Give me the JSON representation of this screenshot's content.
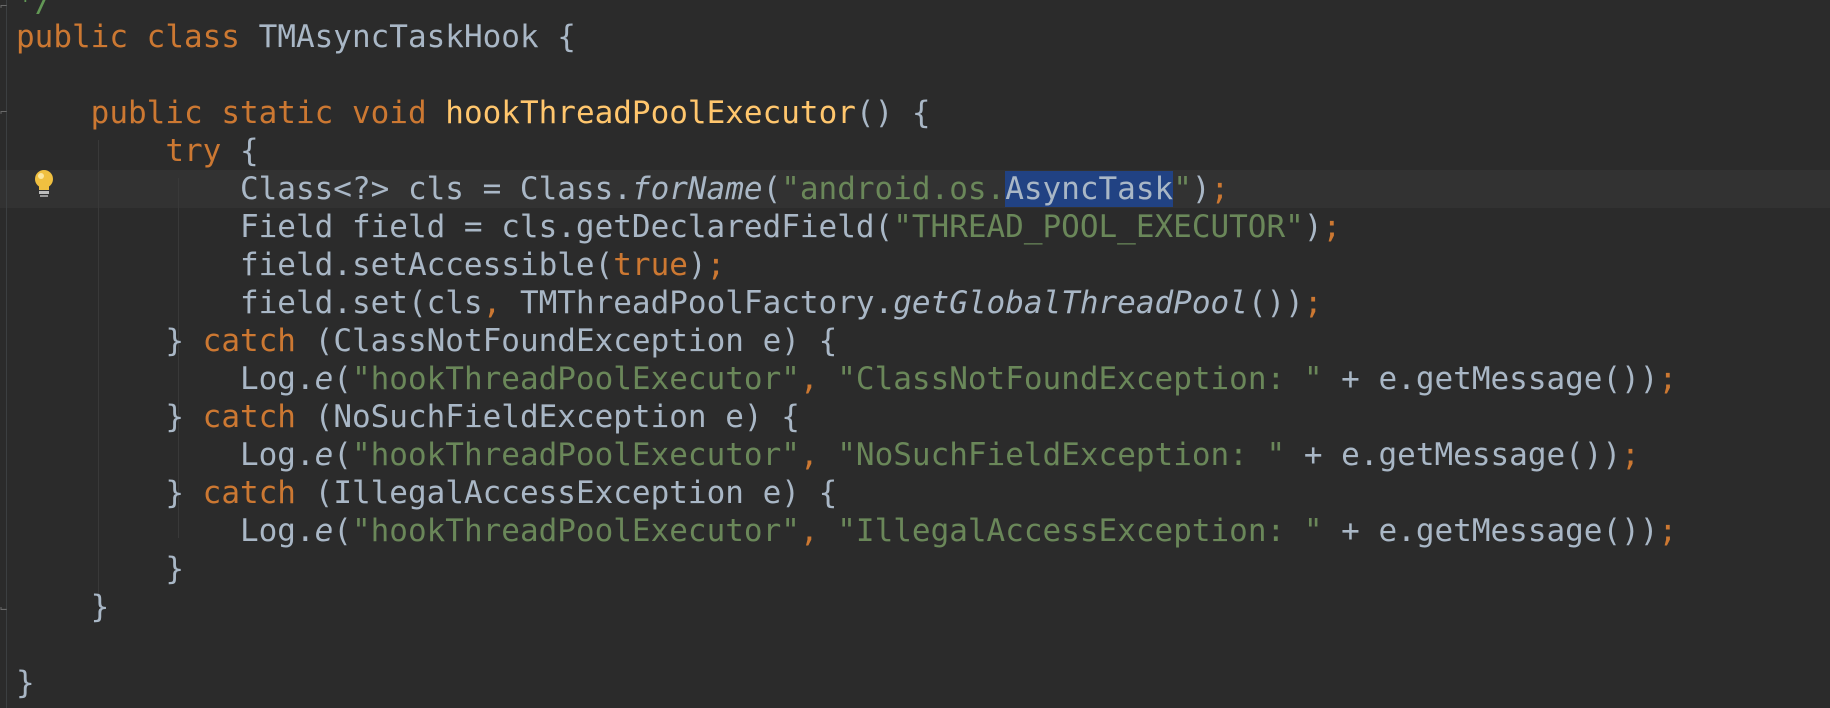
{
  "colors": {
    "background": "#2b2b2b",
    "keyword": "#cc7832",
    "method_decl": "#ffc66d",
    "string": "#6a8759",
    "text": "#a9b7c6",
    "selection": "#214283",
    "current_line": "#323232"
  },
  "icons": {
    "bulb": "lightbulb-icon",
    "fold": "fold-marker-icon"
  },
  "code": {
    "comment_tail": "*/",
    "l1": {
      "kw1": "public",
      "kw2": "class",
      "name": "TMAsyncTaskHook",
      "brace": "{"
    },
    "l3": {
      "kw1": "public",
      "kw2": "static",
      "kw3": "void",
      "method": "hookThreadPoolExecutor",
      "rest": "() {"
    },
    "l4": {
      "kw": "try",
      "rest": "{"
    },
    "l5": {
      "a": "Class<?> cls = Class.",
      "method": "forName",
      "paren": "(",
      "str_open": "\"android.os.",
      "selected": "AsyncTask",
      "str_close": "\"",
      "close": ")",
      "semi": ";"
    },
    "l6": {
      "a": "Field field = cls.getDeclaredField(",
      "str": "\"THREAD_POOL_EXECUTOR\"",
      "close": ")",
      "semi": ";"
    },
    "l7": {
      "a": "field.setAccessible(",
      "kw": "true",
      "close": ")",
      "semi": ";"
    },
    "l8": {
      "a": "field.set(cls",
      "comma": ",",
      "b": " TMThreadPoolFactory.",
      "method": "getGlobalThreadPool",
      "close": "())",
      "semi": ";"
    },
    "l9": {
      "brace": "}",
      "kw": "catch",
      "rest": "(ClassNotFoundException e) {"
    },
    "l10": {
      "a": "Log.",
      "method": "e",
      "paren": "(",
      "tag": "\"hookThreadPoolExecutor\"",
      "comma": ",",
      "msg": "\"ClassNotFoundException: \"",
      "rest": " + e.getMessage())",
      "semi": ";"
    },
    "l11": {
      "brace": "}",
      "kw": "catch",
      "rest": "(NoSuchFieldException e) {"
    },
    "l12": {
      "a": "Log.",
      "method": "e",
      "paren": "(",
      "tag": "\"hookThreadPoolExecutor\"",
      "comma": ",",
      "msg": "\"NoSuchFieldException: \"",
      "rest": " + e.getMessage())",
      "semi": ";"
    },
    "l13": {
      "brace": "}",
      "kw": "catch",
      "rest": "(IllegalAccessException e) {"
    },
    "l14": {
      "a": "Log.",
      "method": "e",
      "paren": "(",
      "tag": "\"hookThreadPoolExecutor\"",
      "comma": ",",
      "msg": "\"IllegalAccessException: \"",
      "rest": " + e.getMessage())",
      "semi": ";"
    },
    "l15": {
      "brace": "}"
    },
    "l16": {
      "brace": "}"
    },
    "l18": {
      "brace": "}"
    }
  }
}
